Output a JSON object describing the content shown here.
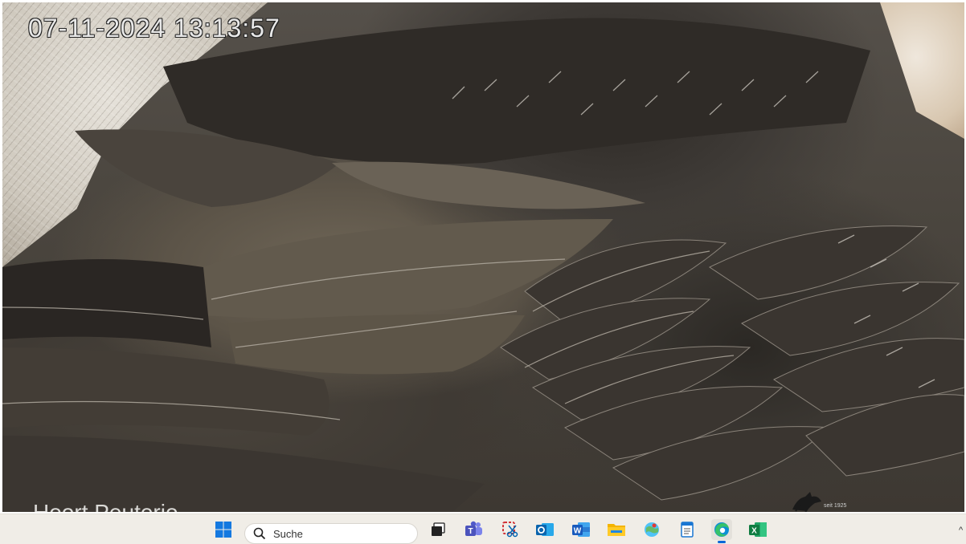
{
  "stream": {
    "timestamp": "07-11-2024 13:13:57",
    "caption_partial": "Hoort Peuterio"
  },
  "watermark": {
    "year_text": "seit 1925"
  },
  "taskbar": {
    "search_placeholder": "Suche",
    "apps": [
      {
        "name": "start",
        "icon": "windows-logo-icon"
      },
      {
        "name": "task-view",
        "icon": "task-view-icon"
      },
      {
        "name": "teams",
        "icon": "teams-icon"
      },
      {
        "name": "snipping-tool",
        "icon": "snipping-tool-icon"
      },
      {
        "name": "outlook",
        "icon": "outlook-icon"
      },
      {
        "name": "word",
        "icon": "word-icon"
      },
      {
        "name": "file-explorer",
        "icon": "folder-icon"
      },
      {
        "name": "maps",
        "icon": "maps-icon"
      },
      {
        "name": "notepad",
        "icon": "notepad-icon"
      },
      {
        "name": "edge",
        "icon": "edge-icon",
        "active": true
      },
      {
        "name": "excel",
        "icon": "excel-icon"
      }
    ],
    "accent": "#0a66d8"
  }
}
